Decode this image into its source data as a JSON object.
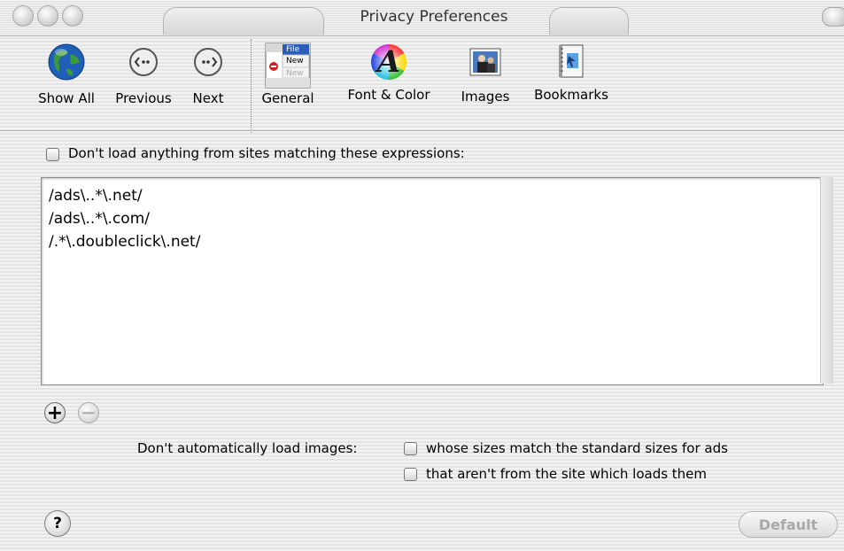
{
  "window": {
    "title": "Privacy Preferences"
  },
  "toolbar": {
    "items": [
      {
        "label": "Show All",
        "icon": "globe-icon"
      },
      {
        "label": "Previous",
        "icon": "previous-icon"
      },
      {
        "label": "Next",
        "icon": "next-icon"
      },
      {
        "label": "General",
        "icon": "general-icon",
        "icon_text": [
          "File",
          "New",
          "New"
        ]
      },
      {
        "label": "Font & Color",
        "icon": "font-color-icon",
        "icon_text": "A"
      },
      {
        "label": "Images",
        "icon": "images-icon"
      },
      {
        "label": "Bookmarks",
        "icon": "bookmarks-icon"
      }
    ]
  },
  "block": {
    "checkbox_label": "Don't load anything from sites matching these expressions:",
    "checked": false,
    "expressions": [
      "/ads\\..*\\.net/",
      "/ads\\..*\\.com/",
      "/.*\\.doubleclick\\.net/"
    ],
    "add_label": "+",
    "remove_label": "−"
  },
  "images": {
    "label": "Don't automatically load images:",
    "options": [
      {
        "label": "whose sizes match the standard sizes for ads",
        "checked": false
      },
      {
        "label": "that aren't from the site which loads them",
        "checked": false
      }
    ]
  },
  "footer": {
    "help_label": "?",
    "default_label": "Default"
  },
  "colors": {
    "globe_blue": "#1f5fb8",
    "globe_green": "#3b9a3a",
    "icon_blue": "#2b5db5"
  }
}
